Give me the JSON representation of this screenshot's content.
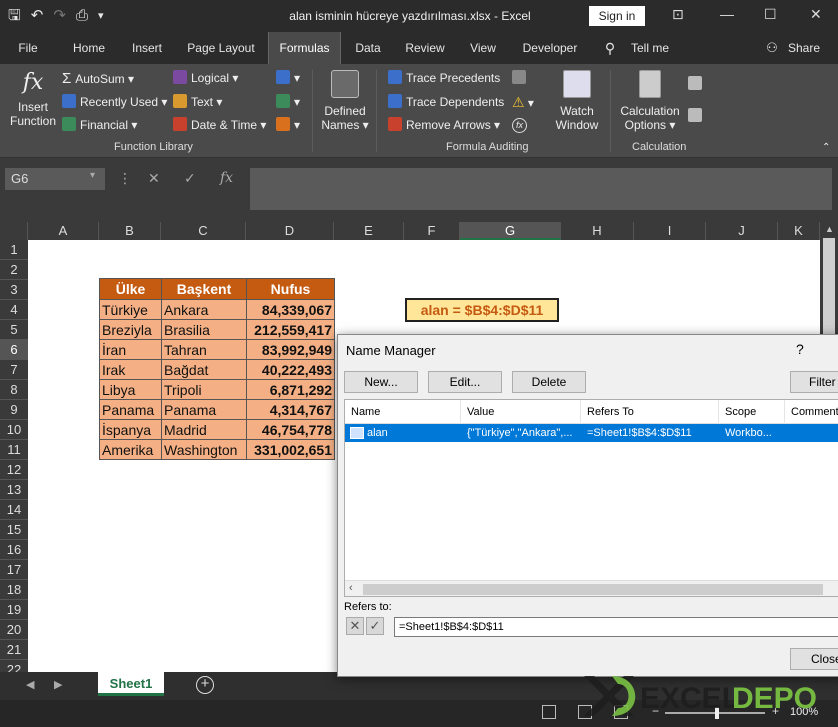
{
  "window": {
    "title": "alan isminin hücreye yazdırılması.xlsx  -  Excel",
    "signin_label": "Sign in"
  },
  "tabs": [
    {
      "label": "File"
    },
    {
      "label": "Home"
    },
    {
      "label": "Insert"
    },
    {
      "label": "Page Layout"
    },
    {
      "label": "Formulas"
    },
    {
      "label": "Data"
    },
    {
      "label": "Review"
    },
    {
      "label": "View"
    },
    {
      "label": "Developer"
    },
    {
      "label": "Tell me"
    },
    {
      "label": "Share"
    }
  ],
  "ribbon": {
    "insert_function": {
      "line1": "Insert",
      "line2": "Function"
    },
    "autosum": "AutoSum",
    "recently_used": "Recently Used",
    "financial": "Financial",
    "logical": "Logical",
    "text": "Text",
    "date_time": "Date & Time",
    "defined_names": {
      "line1": "Defined",
      "line2": "Names"
    },
    "trace_precedents": "Trace Precedents",
    "trace_dependents": "Trace Dependents",
    "remove_arrows": "Remove Arrows",
    "watch_window": {
      "line1": "Watch",
      "line2": "Window"
    },
    "calculation_options": {
      "line1": "Calculation",
      "line2": "Options"
    },
    "group_function_library": "Function Library",
    "group_formula_auditing": "Formula Auditing",
    "group_calculation": "Calculation"
  },
  "formula_bar": {
    "name_box": "G6",
    "formula": ""
  },
  "grid": {
    "columns": [
      "A",
      "B",
      "C",
      "D",
      "E",
      "F",
      "G",
      "H",
      "I",
      "J",
      "K"
    ],
    "rows": [
      "1",
      "2",
      "3",
      "4",
      "5",
      "6",
      "7",
      "8",
      "9",
      "10",
      "11",
      "12",
      "13",
      "14",
      "15",
      "16",
      "17",
      "18",
      "19",
      "20",
      "21",
      "22"
    ],
    "selected_column": "G",
    "selected_row": "6"
  },
  "table": {
    "headers": [
      "Ülke",
      "Başkent",
      "Nufus"
    ],
    "rows": [
      [
        "Türkiye",
        "Ankara",
        "84,339,067"
      ],
      [
        "Breziyla",
        "Brasilia",
        "212,559,417"
      ],
      [
        "İran",
        "Tahran",
        "83,992,949"
      ],
      [
        "Irak",
        "Bağdat",
        "40,222,493"
      ],
      [
        "Libya",
        "Tripoli",
        "6,871,292"
      ],
      [
        "Panama",
        "Panama",
        "4,314,767"
      ],
      [
        "İspanya",
        "Madrid",
        "46,754,778"
      ],
      [
        "Amerika",
        "Washington",
        "331,002,651"
      ]
    ]
  },
  "note_cell": "alan = $B$4:$D$11",
  "sheet_tabs": [
    {
      "label": "Sheet1"
    }
  ],
  "status": {
    "zoom": "100%"
  },
  "name_manager": {
    "title": "Name Manager",
    "help": "?",
    "new_button": "New...",
    "edit_button": "Edit...",
    "delete_button": "Delete",
    "filter_button": "Filter",
    "columns": [
      "Name",
      "Value",
      "Refers To",
      "Scope",
      "Comment"
    ],
    "entries": [
      {
        "name": "alan",
        "value": "{\"Türkiye\",\"Ankara\",...",
        "refers_to": "=Sheet1!$B$4:$D$11",
        "scope": "Workbo..."
      }
    ],
    "refers_to_label": "Refers to:",
    "refers_to_value": "=Sheet1!$B$4:$D$11",
    "close_button": "Close"
  },
  "watermark": {
    "text": "EXCELDEPO"
  },
  "colors": {
    "header": "#c55a11",
    "cell": "#f4b084",
    "note_bg": "#ffe699",
    "excel_green": "#217346",
    "selection": "#0078d7"
  }
}
